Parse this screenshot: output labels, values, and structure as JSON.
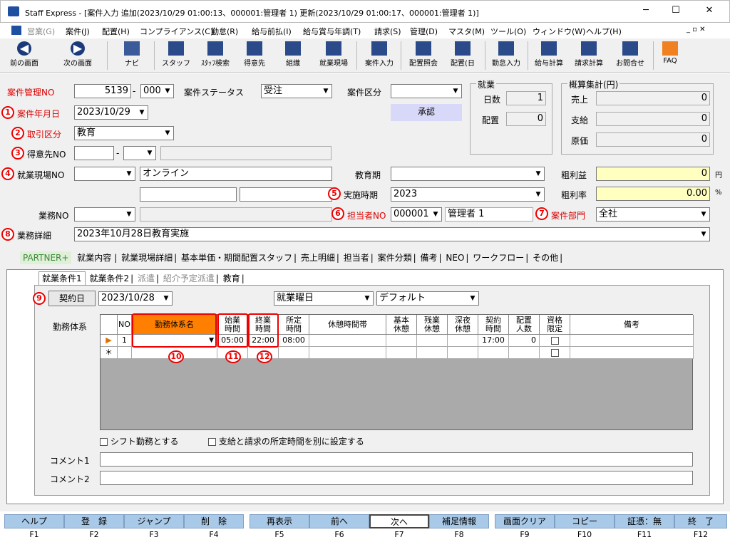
{
  "window": {
    "title": "Staff Express - [案件入力 追加(2023/10/29 01:00:13、000001:管理者 1) 更新(2023/10/29 01:00:17、000001:管理者 1)]",
    "minimize": "─",
    "maximize": "☐",
    "close": "✕"
  },
  "menu": [
    "営業(G)",
    "案件(J)",
    "配置(H)",
    "コンプライアンス(C)",
    "勤怠(R)",
    "給与前払(I)",
    "給与賞与年調(T)",
    "請求(S)",
    "管理(D)",
    "マスタ(M)",
    "ツール(O)",
    "ウィンドウ(W)",
    "ヘルプ(H)"
  ],
  "toolbar": {
    "back": "前の画面",
    "forward": "次の画面",
    "navi": "ナビ",
    "staff": "スタッフ",
    "staff_search": "ｽﾀｯﾌ検索",
    "client": "得意先",
    "org": "組織",
    "site": "就業現場",
    "case": "案件入力",
    "assign_view": "配置照会",
    "assign_day": "配置(日",
    "attendance": "勤怠入力",
    "payroll": "給与計算",
    "billing": "請求計算",
    "contact": "お問合せ",
    "faq": "FAQ"
  },
  "form": {
    "case_no_label": "案件管理NO",
    "case_no": "5139",
    "case_no_sub": "000",
    "status_label": "案件ステータス",
    "status": "受注",
    "type_label": "案件区分",
    "type": "",
    "approve": "承認",
    "date_label": "案件年月日",
    "date": "2023/10/29",
    "deal_label": "取引区分",
    "deal": "教育",
    "client_label": "得意先NO",
    "site_label": "就業現場NO",
    "site_name": "オンライン",
    "edu_period_label": "教育期",
    "edu_period": "",
    "impl_label": "実施時期",
    "impl": "2023",
    "work_no_label": "業務NO",
    "rep_label": "担当者NO",
    "rep_no": "000001",
    "rep_name": "管理者 1",
    "dept_label": "案件部門",
    "dept": "全社",
    "detail_label": "業務詳細",
    "detail": "2023年10月28日教育実施",
    "profit_label": "粗利益",
    "profit": "0",
    "profit_unit": "円",
    "rate_label": "粗利率",
    "rate": "0.00",
    "rate_unit": "%"
  },
  "employment": {
    "title": "就業",
    "days_label": "日数",
    "days": "1",
    "assign_label": "配置",
    "assign": "0"
  },
  "summary": {
    "title": "概算集計(円)",
    "sales_label": "売上",
    "sales": "0",
    "pay_label": "支給",
    "pay": "0",
    "cost_label": "原価",
    "cost": "0"
  },
  "markers": [
    "1",
    "2",
    "3",
    "4",
    "5",
    "6",
    "7",
    "8",
    "9",
    "10",
    "11",
    "12"
  ],
  "tabs": [
    "PARTNER+",
    "就業内容",
    "就業現場詳細",
    "基本単価・期間配置スタッフ",
    "売上明細",
    "担当者",
    "案件分類",
    "備考",
    "NEO",
    "ワークフロー",
    "その他"
  ],
  "subtabs": [
    "就業条件1",
    "就業条件2",
    "派遣",
    "紹介予定派遣",
    "教育"
  ],
  "contract": {
    "button": "契約日",
    "date": "2023/10/28",
    "day_type": "就業曜日",
    "default": "デフォルト"
  },
  "grid": {
    "label": "勤務体系",
    "headers": [
      "NO",
      "勤務体系名",
      "始業時間",
      "終業時間",
      "所定時間",
      "休憩時間帯",
      "基本休憩",
      "残業休憩",
      "深夜休憩",
      "契約時間",
      "配置人数",
      "資格限定",
      "備考"
    ],
    "row": {
      "no": "1",
      "name": "",
      "start": "05:00",
      "end": "22:00",
      "fixed": "08:00",
      "contract": "17:00",
      "people": "0"
    },
    "new_marker": "＊"
  },
  "options": {
    "shift": "シフト勤務とする",
    "separate": "支給と請求の所定時間を別に設定する"
  },
  "comments": {
    "c1": "コメント1",
    "c2": "コメント2"
  },
  "fkeys": [
    {
      "label": "ヘルプ",
      "key": "F1"
    },
    {
      "label": "登　録",
      "key": "F2"
    },
    {
      "label": "ジャンプ",
      "key": "F3"
    },
    {
      "label": "削　除",
      "key": "F4"
    },
    {
      "label": "再表示",
      "key": "F5"
    },
    {
      "label": "前へ",
      "key": "F6"
    },
    {
      "label": "次へ",
      "key": "F7"
    },
    {
      "label": "補足情報",
      "key": "F8"
    },
    {
      "label": "画面クリア",
      "key": "F9"
    },
    {
      "label": "コピー",
      "key": "F10"
    },
    {
      "label": "証憑：無",
      "key": "F11"
    },
    {
      "label": "終　了",
      "key": "F12"
    }
  ],
  "colors": {
    "accent_red": "#e00000",
    "header_orange": "#ff8000",
    "fkey_blue": "#a9c9e8",
    "yellow": "#ffffc0"
  }
}
